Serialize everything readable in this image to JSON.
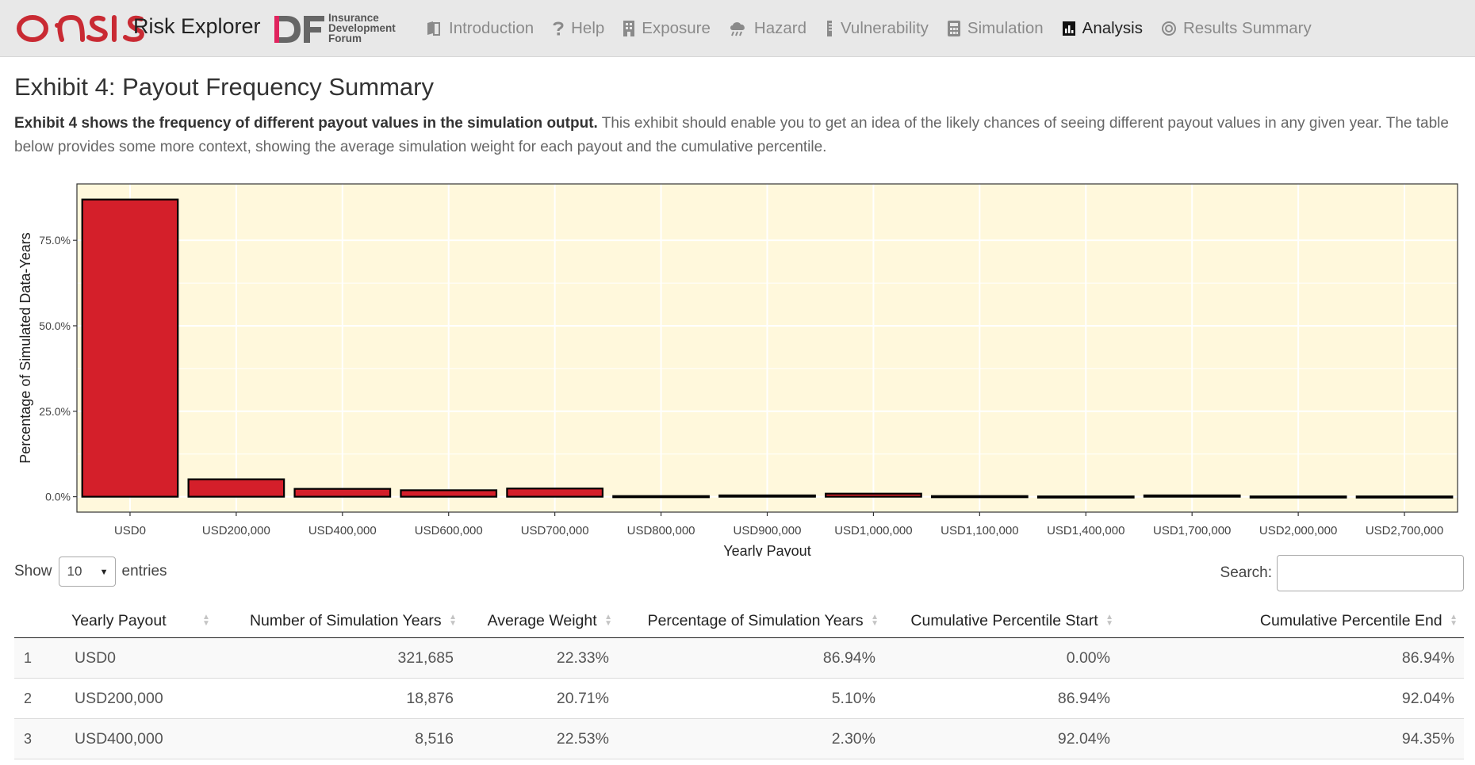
{
  "brand": {
    "title": "Risk Explorer",
    "idf_text": [
      "Insurance",
      "Development",
      "Forum"
    ]
  },
  "nav": {
    "items": [
      {
        "label": "Introduction",
        "icon": "book-icon"
      },
      {
        "label": "Help",
        "icon": "question-icon"
      },
      {
        "label": "Exposure",
        "icon": "building-icon"
      },
      {
        "label": "Hazard",
        "icon": "storm-cloud-icon"
      },
      {
        "label": "Vulnerability",
        "icon": "thermometer-icon"
      },
      {
        "label": "Simulation",
        "icon": "calculator-icon"
      },
      {
        "label": "Analysis",
        "icon": "bar-chart-icon",
        "active": true
      },
      {
        "label": "Results Summary",
        "icon": "bullseye-icon"
      }
    ]
  },
  "page": {
    "title": "Exhibit 4: Payout Frequency Summary",
    "intro_bold": "Exhibit 4 shows the frequency of different payout values in the simulation output.",
    "intro_rest": " This exhibit should enable you to get an idea of the likely chances of seeing different payout values in any given year. The table below provides some more context, showing the average simulation weight for each payout and the cumulative percentile."
  },
  "colors": {
    "bar_fill": "#d41f2a",
    "panel_bg": "#fff8dc",
    "bar_outline": "#000000",
    "nav_bg": "#e8e8e8"
  },
  "chart_data": {
    "type": "bar",
    "xlabel": "Yearly Payout",
    "ylabel": "Percentage of Simulated Data-Years",
    "categories": [
      "USD0",
      "USD200,000",
      "USD400,000",
      "USD600,000",
      "USD700,000",
      "USD800,000",
      "USD900,000",
      "USD1,000,000",
      "USD1,100,000",
      "USD1,400,000",
      "USD1,700,000",
      "USD2,000,000",
      "USD2,700,000"
    ],
    "values": [
      86.94,
      5.1,
      2.3,
      1.9,
      2.4,
      0.2,
      0.4,
      0.9,
      0.2,
      0.1,
      0.4,
      0.1,
      0.1
    ],
    "yticks": [
      0,
      25,
      50,
      75
    ],
    "ytick_labels": [
      "0.0%",
      "25.0%",
      "50.0%",
      "75.0%"
    ],
    "ylim": [
      -4.5,
      91.5
    ],
    "grid": true,
    "legend": "none"
  },
  "table": {
    "show_label": "Show",
    "entries_label": "entries",
    "length_value": "10",
    "search_label": "Search:",
    "headers": [
      "Yearly Payout",
      "Number of Simulation Years",
      "Average Weight",
      "Percentage of Simulation Years",
      "Cumulative Percentile Start",
      "Cumulative Percentile End"
    ],
    "rows": [
      {
        "idx": "1",
        "payout": "USD0",
        "years": "321,685",
        "weight": "22.33%",
        "pct": "86.94%",
        "start": "0.00%",
        "end": "86.94%"
      },
      {
        "idx": "2",
        "payout": "USD200,000",
        "years": "18,876",
        "weight": "20.71%",
        "pct": "5.10%",
        "start": "86.94%",
        "end": "92.04%"
      },
      {
        "idx": "3",
        "payout": "USD400,000",
        "years": "8,516",
        "weight": "22.53%",
        "pct": "2.30%",
        "start": "92.04%",
        "end": "94.35%"
      }
    ]
  }
}
